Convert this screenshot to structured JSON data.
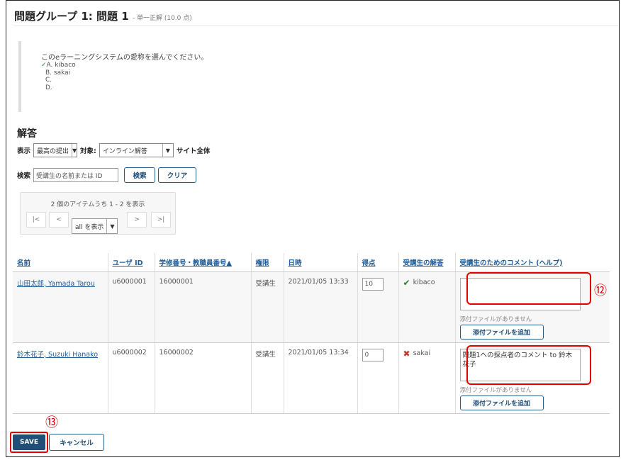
{
  "question": {
    "title": "問題グループ 1: 問題 1",
    "subtitle": "- 単一正解 (10.0 点)",
    "text": "このeラーニングシステムの愛称を選んでください。",
    "options": [
      {
        "label": "A. kibaco",
        "correct": true
      },
      {
        "label": "B. sakai",
        "correct": false
      },
      {
        "label": "C.",
        "correct": false
      },
      {
        "label": "D.",
        "correct": false
      }
    ]
  },
  "answers_section": {
    "title": "解答",
    "view_label": "表示",
    "view_value": "最高の提出",
    "target_label": "対象:",
    "target_value": "インライン解答",
    "site_label": "サイト全体",
    "search_label": "検索",
    "search_value": "受講生の名前または ID",
    "search_button": "検索",
    "clear_button": "クリア"
  },
  "pager": {
    "info": "2 個のアイテムうち 1 - 2 を表示",
    "first": "|<",
    "prev": "<",
    "show_value": "all を表示",
    "next": ">",
    "last": ">|"
  },
  "table": {
    "headers": [
      "名前",
      "ユーザ ID",
      "学修番号・教職員番号▲",
      "権限",
      "日時",
      "得点",
      "受講生の解答",
      "受講生のためのコメント (ヘルプ)"
    ],
    "rows": [
      {
        "name": "山田太郎, Yamada Tarou",
        "user_id": "u6000001",
        "number": "16000001",
        "role": "受講生",
        "datetime": "2021/01/05 13:33",
        "score": "10",
        "answer": "kibaco",
        "answer_correct": true,
        "comment": "",
        "no_file": "添付ファイルがありません",
        "attach_button": "添付ファイルを追加"
      },
      {
        "name": "鈴木花子, Suzuki Hanako",
        "user_id": "u6000002",
        "number": "16000002",
        "role": "受講生",
        "datetime": "2021/01/05 13:34",
        "score": "0",
        "answer": "sakai",
        "answer_correct": false,
        "comment": "問題1への採点者のコメント to 鈴木花子",
        "no_file": "添付ファイルがありません",
        "attach_button": "添付ファイルを追加"
      }
    ]
  },
  "annotations": {
    "circle_12": "⑫",
    "circle_13": "⑬"
  },
  "footer": {
    "save": "SAVE",
    "cancel": "キャンセル"
  },
  "colors": {
    "primary": "#1f4e79",
    "link": "#1f5c99",
    "highlight": "#e00000",
    "correct": "#2e7d32",
    "wrong": "#c0392b"
  }
}
